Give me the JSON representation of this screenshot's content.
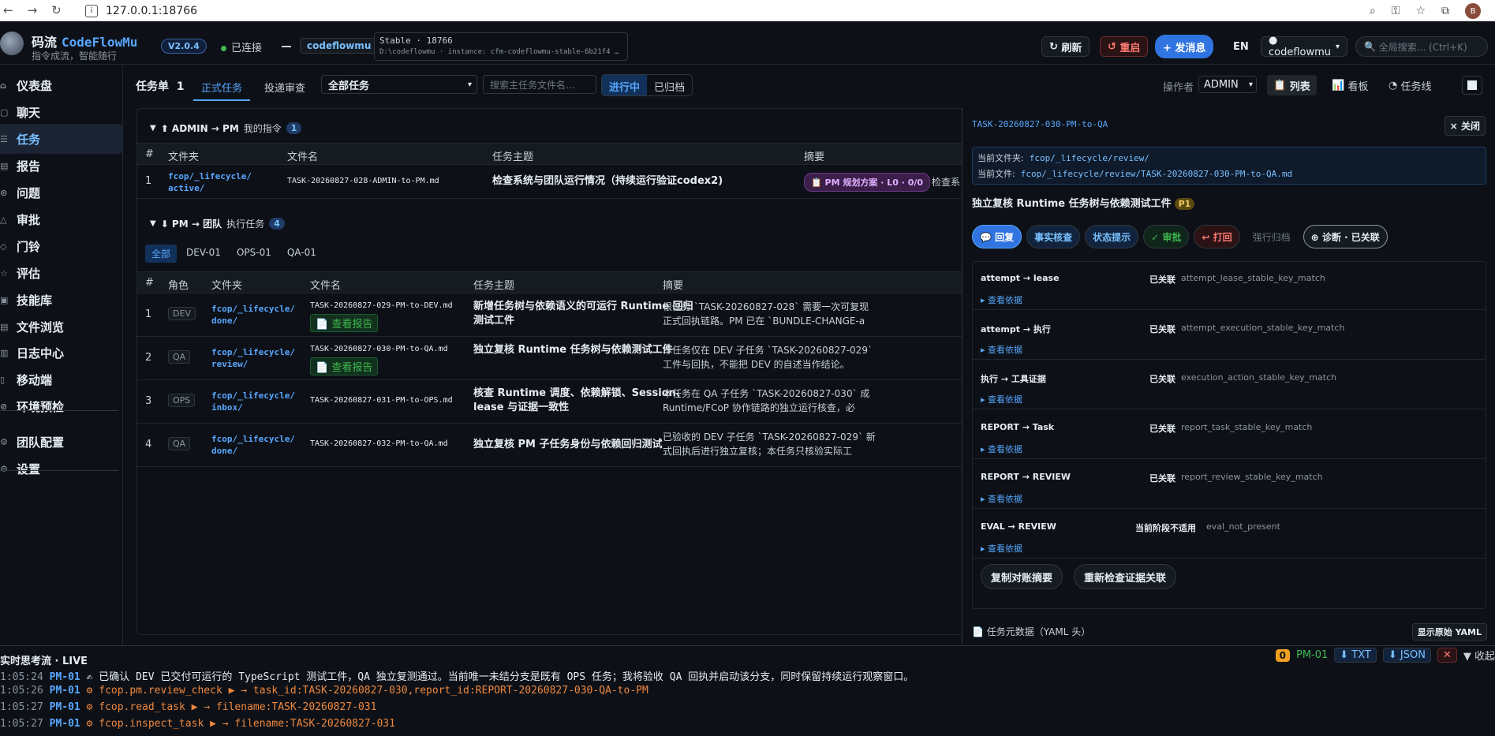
{
  "browser": {
    "url": "127.0.0.1:18766",
    "avatar": "B"
  },
  "header": {
    "brand_cn": "码流",
    "brand_en": "CodeFlowMu",
    "slogan": "指令成流，智能随行",
    "version": "V2.0.4",
    "connection": "已连接",
    "project": "codeflowmu",
    "instance_title": "Stable · 18766",
    "instance_path": "D:\\codeflowmu · instance: cfm-codeflowmu-stable-6b21f4 …",
    "refresh": "刷新",
    "restart": "重启",
    "send": "+ 发消息",
    "lang": "EN",
    "team_select": "● codeflowmu",
    "search_placeholder": "全局搜索... (Ctrl+K)"
  },
  "sidebar": {
    "items": [
      {
        "label": "仪表盘",
        "icon": "dashboard-icon"
      },
      {
        "label": "聊天",
        "icon": "chat-icon"
      },
      {
        "label": "任务",
        "icon": "task-icon"
      },
      {
        "label": "报告",
        "icon": "report-icon"
      },
      {
        "label": "问题",
        "icon": "issue-icon"
      },
      {
        "label": "审批",
        "icon": "approval-icon"
      },
      {
        "label": "门铃",
        "icon": "bell-icon"
      },
      {
        "label": "评估",
        "icon": "eval-icon"
      },
      {
        "label": "技能库",
        "icon": "skills-icon"
      },
      {
        "label": "文件浏览",
        "icon": "files-icon"
      },
      {
        "label": "日志中心",
        "icon": "logs-icon"
      },
      {
        "label": "移动端",
        "icon": "mobile-icon"
      },
      {
        "label": "环境预检",
        "icon": "precheck-icon"
      },
      {
        "label": "团队配置",
        "icon": "team-config-icon"
      },
      {
        "label": "设置",
        "icon": "settings-icon"
      }
    ]
  },
  "main": {
    "title": "任务单",
    "title_count": "1",
    "tabs": [
      "正式任务",
      "投递审查"
    ],
    "filter": "全部任务",
    "search_placeholder": "搜索主任务文件名…",
    "status_tabs": [
      "进行中",
      "已归档"
    ],
    "operator_label": "操作者",
    "operator": "ADMIN",
    "views": [
      "列表",
      "看板",
      "任务线"
    ]
  },
  "section1": {
    "title": "⬆ ADMIN → PM",
    "sub": "我的指令",
    "count": "1",
    "cols": [
      "#",
      "文件夹",
      "文件名",
      "任务主题",
      "摘要"
    ],
    "rows": [
      {
        "n": "1",
        "folder": "fcop/_lifecycle/active/",
        "file": "TASK-20260827-028-ADMIN-to-PM.md",
        "subject": "检查系统与团队运行情况（持续运行验证codex2)",
        "plan": "📋 PM 规划方案 · L0 · 0/0",
        "summary": "检查系"
      }
    ]
  },
  "section2": {
    "title": "⬇ PM → 团队",
    "sub": "执行任务",
    "count": "4",
    "filters": [
      "全部",
      "DEV-01",
      "OPS-01",
      "QA-01"
    ],
    "cols": [
      "#",
      "角色",
      "文件夹",
      "文件名",
      "任务主题",
      "摘要"
    ],
    "report_label": "📄 查看报告",
    "rows": [
      {
        "n": "1",
        "role": "DEV",
        "folder": "fcop/_lifecycle/done/",
        "file": "TASK-20260827-029-PM-to-DEV.md",
        "subject": "新增任务树与依赖语义的可运行 Runtime 回归测试工件",
        "summary1": "根任务 `TASK-20260827-028` 需要一次可复现",
        "summary2": "正式回执链路。PM 已在 `BUNDLE-CHANGE-a"
      },
      {
        "n": "2",
        "role": "QA",
        "folder": "fcop/_lifecycle/review/",
        "file": "TASK-20260827-030-PM-to-QA.md",
        "subject": "独立复核 Runtime 任务树与依赖测试工件",
        "summary1": "本任务仅在 DEV 子任务 `TASK-20260827-029`",
        "summary2": "工件与回执，不能把 DEV 的自述当作结论。"
      },
      {
        "n": "3",
        "role": "OPS",
        "folder": "fcop/_lifecycle/inbox/",
        "file": "TASK-20260827-031-PM-to-OPS.md",
        "subject": "核查 Runtime 调度、依赖解锁、Session、lease 与证据一致性",
        "summary1": "本任务在 QA 子任务 `TASK-20260827-030` 成",
        "summary2": "Runtime/FCoP 协作链路的独立运行核查，必"
      },
      {
        "n": "4",
        "role": "QA",
        "folder": "fcop/_lifecycle/done/",
        "file": "TASK-20260827-032-PM-to-QA.md",
        "subject": "独立复核 PM 子任务身份与依赖回归测试",
        "summary1": "已验收的 DEV 子任务 `TASK-20260827-029` 新",
        "summary2": "式回执后进行独立复核；本任务只核验实际工"
      }
    ]
  },
  "drawer": {
    "task_id": "TASK-20260827-030-PM-to-QA",
    "close": "× 关闭",
    "folder_label": "当前文件夹:",
    "folder": "fcop/_lifecycle/review/",
    "file_label": "当前文件:",
    "file": "fcop/_lifecycle/review/TASK-20260827-030-PM-to-QA.md",
    "title": "独立复核 Runtime 任务树与依赖测试工件",
    "priority": "P1",
    "actions": [
      "💬 回复",
      "事实核查",
      "状态提示",
      "✓ 审批",
      "↩ 打回",
      "强行归档",
      "⊕ 诊断 · 已关联"
    ],
    "evidence": [
      {
        "name": "attempt → lease",
        "status": "已关联",
        "key": "attempt_lease_stable_key_match"
      },
      {
        "name": "attempt → 执行",
        "status": "已关联",
        "key": "attempt_execution_stable_key_match"
      },
      {
        "name": "执行 → 工具证据",
        "status": "已关联",
        "key": "execution_action_stable_key_match"
      },
      {
        "name": "REPORT → Task",
        "status": "已关联",
        "key": "report_task_stable_key_match"
      },
      {
        "name": "REPORT → REVIEW",
        "status": "已关联",
        "key": "report_review_stable_key_match"
      },
      {
        "name": "EVAL → REVIEW",
        "status": "当前阶段不适用",
        "key": "eval_not_present"
      }
    ],
    "more_label": "▸ 查看依据",
    "copy_btn": "复制对账摘要",
    "recheck_btn": "重新检查证据关联",
    "meta_label": "📄 任务元数据（YAML 头）",
    "meta_btn": "显示原始 YAML"
  },
  "live": {
    "title": "实时思考流 · LIVE",
    "count": "0",
    "agent": "PM-01",
    "txt": "⬇ TXT",
    "json": "⬇ JSON",
    "collapse": "▼ 收起",
    "lines": [
      {
        "t": "1:05:24",
        "who": "PM-01",
        "msg": "✍ 已确认 DEV 已交付可运行的 TypeScript 测试工件，QA 独立复测通过。当前唯一未结分支是既有 OPS 任务；我将验收 QA 回执并启动该分支，同时保留持续运行观察窗口。",
        "tool": ""
      },
      {
        "t": "1:05:26",
        "who": "PM-01",
        "msg": "",
        "tool": "⚙ fcop.pm.review_check ▶ → task_id:TASK-20260827-030,report_id:REPORT-20260827-030-QA-to-PM"
      },
      {
        "t": "1:05:27",
        "who": "PM-01",
        "msg": "",
        "tool": "⚙ fcop.read_task ▶ → filename:TASK-20260827-031"
      },
      {
        "t": "1:05:27",
        "who": "PM-01",
        "msg": "",
        "tool": "⚙ fcop.inspect_task ▶ → filename:TASK-20260827-031"
      }
    ]
  }
}
